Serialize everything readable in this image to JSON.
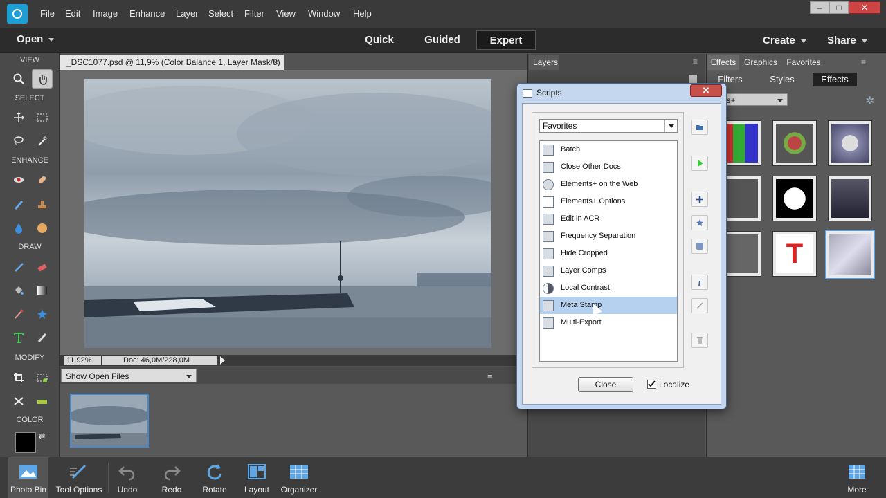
{
  "menubar": {
    "items": [
      "File",
      "Edit",
      "Image",
      "Enhance",
      "Layer",
      "Select",
      "Filter",
      "View",
      "Window",
      "Help"
    ]
  },
  "modebar": {
    "open_label": "Open",
    "modes": [
      "Quick",
      "Guided",
      "Expert"
    ],
    "active_mode": "Expert",
    "create_label": "Create",
    "share_label": "Share"
  },
  "toolbox": {
    "sections": [
      "VIEW",
      "SELECT",
      "ENHANCE",
      "DRAW",
      "MODIFY",
      "COLOR"
    ]
  },
  "document": {
    "tab_title": "_DSC1077.psd @ 11,9% (Color Balance 1, Layer Mask/8) *",
    "close_symbol": "×",
    "zoom": "11.92%",
    "doc_info": "Doc: 46,0M/228,0M"
  },
  "photo_bin": {
    "select_value": "Show Open Files"
  },
  "layers_panel": {
    "tab": "Layers"
  },
  "effects_panel": {
    "tabs": [
      "Effects",
      "Graphics",
      "Favorites"
    ],
    "subtabs": [
      "Filters",
      "Styles",
      "Effects"
    ],
    "dropdown_value": "ments+"
  },
  "bottombar": {
    "items": [
      "Photo Bin",
      "Tool Options",
      "Undo",
      "Redo",
      "Rotate",
      "Layout",
      "Organizer",
      "More"
    ]
  },
  "dialog": {
    "title": "Scripts",
    "category": "Favorites",
    "scripts": [
      "Batch",
      "Close Other Docs",
      "Elements+ on the Web",
      "Elements+ Options",
      "Edit in ACR",
      "Frequency Separation",
      "Hide Cropped",
      "Layer Comps",
      "Local Contrast",
      "Meta Stamp",
      "Multi-Export"
    ],
    "selected_script": "Meta Stamp",
    "close_button": "Close",
    "localize_label": "Localize",
    "localize_checked": true
  }
}
